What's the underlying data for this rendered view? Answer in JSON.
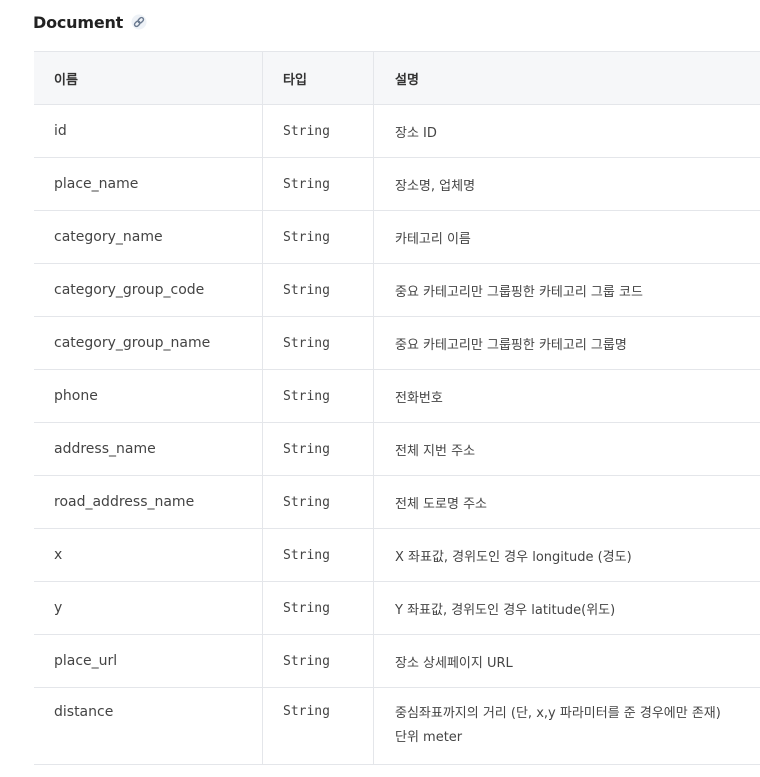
{
  "section": {
    "title": "Document",
    "icon": "link-icon"
  },
  "table": {
    "headers": [
      "이름",
      "타입",
      "설명"
    ],
    "rows": [
      {
        "name": "id",
        "type": "String",
        "desc": "장소 ID"
      },
      {
        "name": "place_name",
        "type": "String",
        "desc": "장소명, 업체명"
      },
      {
        "name": "category_name",
        "type": "String",
        "desc": "카테고리 이름"
      },
      {
        "name": "category_group_code",
        "type": "String",
        "desc": "중요 카테고리만 그룹핑한 카테고리 그룹 코드"
      },
      {
        "name": "category_group_name",
        "type": "String",
        "desc": "중요 카테고리만 그룹핑한 카테고리 그룹명"
      },
      {
        "name": "phone",
        "type": "String",
        "desc": "전화번호"
      },
      {
        "name": "address_name",
        "type": "String",
        "desc": "전체 지번 주소"
      },
      {
        "name": "road_address_name",
        "type": "String",
        "desc": "전체 도로명 주소"
      },
      {
        "name": "x",
        "type": "String",
        "desc": "X 좌표값, 경위도인 경우 longitude (경도)"
      },
      {
        "name": "y",
        "type": "String",
        "desc": "Y 좌표값, 경위도인 경우 latitude(위도)"
      },
      {
        "name": "place_url",
        "type": "String",
        "desc": "장소 상세페이지 URL"
      },
      {
        "name": "distance",
        "type": "String",
        "desc": "중심좌표까지의 거리 (단, x,y 파라미터를 준 경우에만 존재)",
        "desc_line2": "단위 meter"
      }
    ]
  }
}
